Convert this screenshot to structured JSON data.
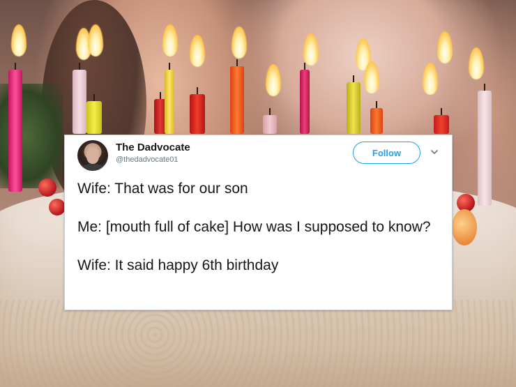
{
  "tweet": {
    "author_name": "The Dadvocate",
    "author_handle": "@thedadvocate01",
    "follow_label": "Follow",
    "lines": [
      "Wife: That was for our son",
      "Me: [mouth full of cake] How was I supposed to know?",
      "Wife: It said happy 6th birthday"
    ]
  },
  "colors": {
    "accent": "#1da1f2",
    "text": "#14171a",
    "secondary_text": "#657786"
  },
  "icons": {
    "chevron": "chevron-down-icon",
    "avatar": "avatar"
  }
}
